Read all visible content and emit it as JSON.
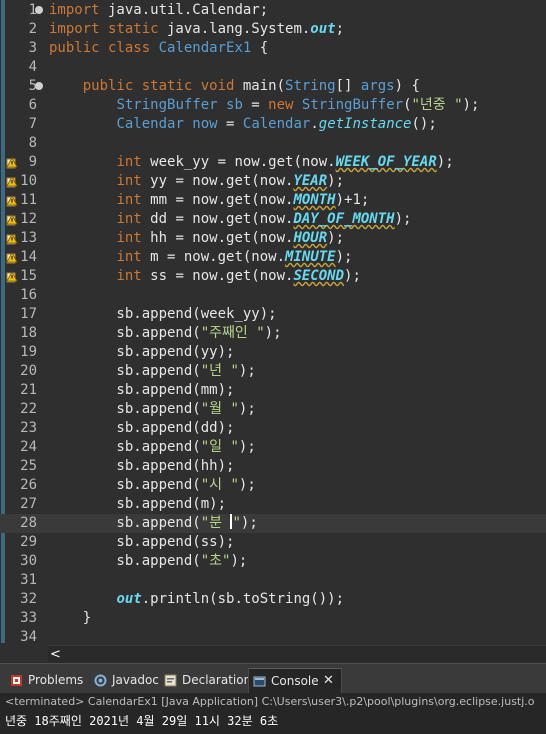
{
  "editor": {
    "lines": [
      {
        "n": "1",
        "segs": [
          [
            "kw",
            "import"
          ],
          [
            "st",
            " java.util.Calendar;"
          ]
        ]
      },
      {
        "n": "2",
        "segs": [
          [
            "kw",
            "import static"
          ],
          [
            "st",
            " java.lang.System."
          ],
          [
            "out",
            "out"
          ],
          [
            "st",
            ";"
          ]
        ]
      },
      {
        "n": "3",
        "segs": [
          [
            "kw",
            "public class"
          ],
          [
            "st",
            " "
          ],
          [
            "ty",
            "CalendarEx1"
          ],
          [
            "st",
            " {"
          ]
        ]
      },
      {
        "n": "4",
        "segs": []
      },
      {
        "n": "5",
        "segs": [
          [
            "st",
            "    "
          ],
          [
            "kw",
            "public static void"
          ],
          [
            "st",
            " main("
          ],
          [
            "ty",
            "String"
          ],
          [
            "st",
            "[] "
          ],
          [
            "ty",
            "args"
          ],
          [
            "st",
            ") {"
          ]
        ]
      },
      {
        "n": "6",
        "segs": [
          [
            "st",
            "        "
          ],
          [
            "ty",
            "StringBuffer sb"
          ],
          [
            "st",
            " = "
          ],
          [
            "kw",
            "new"
          ],
          [
            "st",
            " "
          ],
          [
            "ty",
            "StringBuffer"
          ],
          [
            "st",
            "("
          ],
          [
            "str",
            "\"년중 \""
          ],
          [
            "st",
            ");"
          ]
        ]
      },
      {
        "n": "7",
        "segs": [
          [
            "st",
            "        "
          ],
          [
            "ty",
            "Calendar now"
          ],
          [
            "st",
            " = "
          ],
          [
            "ty",
            "Calendar"
          ],
          [
            "st",
            "."
          ],
          [
            "sm",
            "getInstance"
          ],
          [
            "st",
            "();"
          ]
        ]
      },
      {
        "n": "8",
        "segs": []
      },
      {
        "n": "9",
        "segs": [
          [
            "st",
            "        "
          ],
          [
            "kw",
            "int"
          ],
          [
            "st",
            " week_yy = now.get(now."
          ],
          [
            "fld",
            "WEEK_OF_YEAR"
          ],
          [
            "st",
            ");"
          ]
        ]
      },
      {
        "n": "10",
        "segs": [
          [
            "st",
            "        "
          ],
          [
            "kw",
            "int"
          ],
          [
            "st",
            " yy = now.get(now."
          ],
          [
            "fld",
            "YEAR"
          ],
          [
            "st",
            ");"
          ]
        ]
      },
      {
        "n": "11",
        "segs": [
          [
            "st",
            "        "
          ],
          [
            "kw",
            "int"
          ],
          [
            "st",
            " mm = now.get(now."
          ],
          [
            "fld",
            "MONTH"
          ],
          [
            "st",
            ")+1;"
          ]
        ]
      },
      {
        "n": "12",
        "segs": [
          [
            "st",
            "        "
          ],
          [
            "kw",
            "int"
          ],
          [
            "st",
            " dd = now.get(now."
          ],
          [
            "fld",
            "DAY_OF_MONTH"
          ],
          [
            "st",
            ");"
          ]
        ]
      },
      {
        "n": "13",
        "segs": [
          [
            "st",
            "        "
          ],
          [
            "kw",
            "int"
          ],
          [
            "st",
            " hh = now.get(now."
          ],
          [
            "fld",
            "HOUR"
          ],
          [
            "st",
            ");"
          ]
        ]
      },
      {
        "n": "14",
        "segs": [
          [
            "st",
            "        "
          ],
          [
            "kw",
            "int"
          ],
          [
            "st",
            " m = now.get(now."
          ],
          [
            "fld",
            "MINUTE"
          ],
          [
            "st",
            ");"
          ]
        ]
      },
      {
        "n": "15",
        "segs": [
          [
            "st",
            "        "
          ],
          [
            "kw",
            "int"
          ],
          [
            "st",
            " ss = now.get(now."
          ],
          [
            "fld",
            "SECOND"
          ],
          [
            "st",
            ");"
          ]
        ]
      },
      {
        "n": "16",
        "segs": []
      },
      {
        "n": "17",
        "segs": [
          [
            "st",
            "        sb.append(week_yy);"
          ]
        ]
      },
      {
        "n": "18",
        "segs": [
          [
            "st",
            "        sb.append("
          ],
          [
            "str",
            "\"주째인 \""
          ],
          [
            "st",
            ");"
          ]
        ]
      },
      {
        "n": "19",
        "segs": [
          [
            "st",
            "        sb.append(yy);"
          ]
        ]
      },
      {
        "n": "20",
        "segs": [
          [
            "st",
            "        sb.append("
          ],
          [
            "str",
            "\"년 \""
          ],
          [
            "st",
            ");"
          ]
        ]
      },
      {
        "n": "21",
        "segs": [
          [
            "st",
            "        sb.append(mm);"
          ]
        ]
      },
      {
        "n": "22",
        "segs": [
          [
            "st",
            "        sb.append("
          ],
          [
            "str",
            "\"월 \""
          ],
          [
            "st",
            ");"
          ]
        ]
      },
      {
        "n": "23",
        "segs": [
          [
            "st",
            "        sb.append(dd);"
          ]
        ]
      },
      {
        "n": "24",
        "segs": [
          [
            "st",
            "        sb.append("
          ],
          [
            "str",
            "\"일 \""
          ],
          [
            "st",
            ");"
          ]
        ]
      },
      {
        "n": "25",
        "segs": [
          [
            "st",
            "        sb.append(hh);"
          ]
        ]
      },
      {
        "n": "26",
        "segs": [
          [
            "st",
            "        sb.append("
          ],
          [
            "str",
            "\"시 \""
          ],
          [
            "st",
            ");"
          ]
        ]
      },
      {
        "n": "27",
        "segs": [
          [
            "st",
            "        sb.append(m);"
          ]
        ]
      },
      {
        "n": "28",
        "segs": [
          [
            "st",
            "        sb.append("
          ],
          [
            "str",
            "\"분 "
          ],
          [
            "caret",
            ""
          ],
          [
            "str",
            "\""
          ],
          [
            "st",
            ");"
          ]
        ]
      },
      {
        "n": "29",
        "segs": [
          [
            "st",
            "        sb.append(ss);"
          ]
        ]
      },
      {
        "n": "30",
        "segs": [
          [
            "st",
            "        sb.append("
          ],
          [
            "str",
            "\"초\""
          ],
          [
            "st",
            ");"
          ]
        ]
      },
      {
        "n": "31",
        "segs": []
      },
      {
        "n": "32",
        "segs": [
          [
            "st",
            "        "
          ],
          [
            "out",
            "out"
          ],
          [
            "st",
            ".println(sb.toString());"
          ]
        ]
      },
      {
        "n": "33",
        "segs": [
          [
            "st",
            "    }"
          ]
        ]
      },
      {
        "n": "34",
        "segs": []
      }
    ],
    "current_line": "28",
    "warning_lines": [
      "9",
      "10",
      "11",
      "12",
      "13",
      "14",
      "15"
    ],
    "fold_lines": [
      "1",
      "5"
    ]
  },
  "hscroll": {
    "arrow": "<"
  },
  "views": {
    "tabs": [
      {
        "id": "problems",
        "label": "Problems",
        "icon": "problems-icon"
      },
      {
        "id": "javadoc",
        "label": "Javadoc",
        "icon": "javadoc-icon"
      },
      {
        "id": "declaration",
        "label": "Declaration",
        "icon": "declaration-icon"
      },
      {
        "id": "console",
        "label": "Console",
        "icon": "console-icon",
        "close": "✕"
      }
    ],
    "active": "console"
  },
  "console": {
    "terminated": "<terminated> CalendarEx1 [Java Application] C:\\Users\\user3\\.p2\\pool\\plugins\\org.eclipse.justj.o",
    "output": "년중 18주째인 2021년 4월 29일 11시 32분 6초"
  },
  "colors": {
    "accent": "#3c6a84",
    "keyword": "#cc7832",
    "type": "#5a9fd4",
    "string": "#b9d48a",
    "field": "#66d9ef"
  }
}
